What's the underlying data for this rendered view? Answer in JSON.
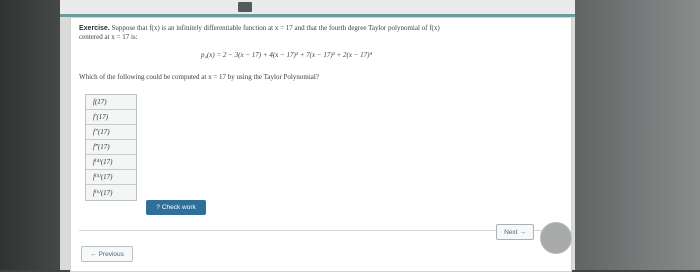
{
  "exercise": {
    "label": "Exercise.",
    "text_line1": "Suppose that f(x) is an infinitely differentiable function at x = 17 and that the fourth degree Taylor polynomial of f(x)",
    "text_line2": "centered at x = 17 is:",
    "formula": "p₄(x) = 2 − 3(x − 17) + 4(x − 17)² + 7(x − 17)³ + 2(x − 17)⁴",
    "prompt": "Which of the following could be computed at x = 17 by using the Taylor Polynomial?"
  },
  "options": [
    "f(17)",
    "f′(17)",
    "f″(17)",
    "f‴(17)",
    "f⁽⁴⁾(17)",
    "f⁽⁵⁾(17)",
    "f⁽⁶⁾(17)"
  ],
  "buttons": {
    "check_work_icon": "?",
    "check_work": "Check work",
    "next": "Next",
    "next_icon": "→",
    "previous": "Previous",
    "previous_icon": "←"
  },
  "colors": {
    "accent": "#2f6f9a",
    "link": "#3c6f8c"
  }
}
